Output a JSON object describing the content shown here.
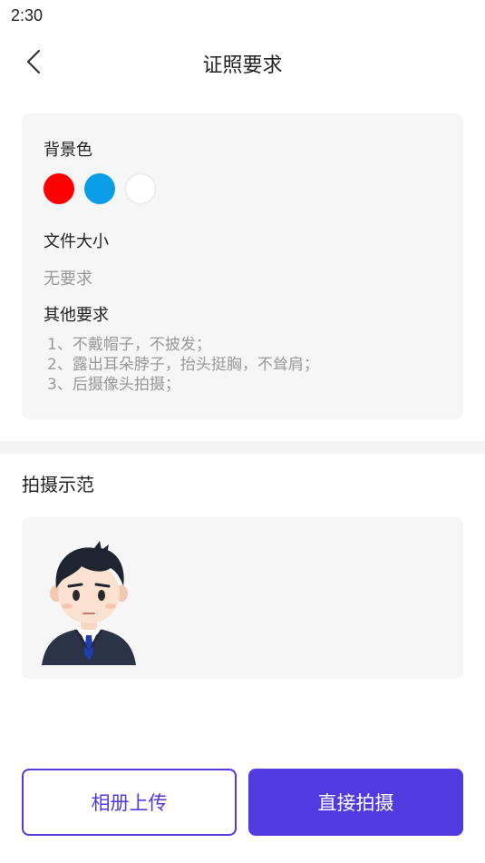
{
  "status_bar": {
    "time": "2:30"
  },
  "nav": {
    "title": "证照要求",
    "back_icon": "chevron-left-icon"
  },
  "requirements": {
    "background_color_label": "背景色",
    "background_colors": [
      {
        "name": "red",
        "hex": "#ff0000"
      },
      {
        "name": "blue",
        "hex": "#0a9de8"
      },
      {
        "name": "white",
        "hex": "#ffffff"
      }
    ],
    "file_size_label": "文件大小",
    "file_size_value": "无要求",
    "other_label": "其他要求",
    "other_items": [
      "1、不戴帽子，不披发；",
      "2、露出耳朵脖子，抬头挺胸，不耸肩；",
      "3、后摄像头拍摄；"
    ]
  },
  "demo": {
    "title": "拍摄示范"
  },
  "actions": {
    "album_upload": "相册上传",
    "shoot_direct": "直接拍摄"
  },
  "colors": {
    "accent": "#4f3be0",
    "card_bg": "#f6f6f6",
    "muted_text": "#999999"
  }
}
